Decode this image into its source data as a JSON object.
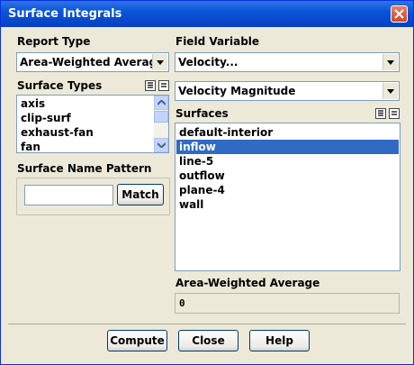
{
  "window": {
    "title": "Surface Integrals"
  },
  "report_type": {
    "label": "Report Type",
    "value": "Area-Weighted Average"
  },
  "surface_types": {
    "label": "Surface Types",
    "items": [
      "axis",
      "clip-surf",
      "exhaust-fan",
      "fan"
    ]
  },
  "surface_name_pattern": {
    "label": "Surface Name Pattern",
    "value": "",
    "match_label": "Match"
  },
  "field_variable": {
    "label": "Field Variable",
    "category": "Velocity...",
    "variable": "Velocity Magnitude"
  },
  "surfaces": {
    "label": "Surfaces",
    "items": [
      "default-interior",
      "inflow",
      "line-5",
      "outflow",
      "plane-4",
      "wall"
    ],
    "selected": "inflow"
  },
  "result": {
    "label": "Area-Weighted Average",
    "value": "0"
  },
  "buttons": {
    "compute": "Compute",
    "close": "Close",
    "help": "Help"
  },
  "icons": {
    "close": "close-icon",
    "dropdown": "chevron-down-icon",
    "select_all": "select-all-icon",
    "deselect_all": "deselect-all-icon"
  },
  "colors": {
    "title_bar": "#0a55d9",
    "selection": "#316ac5",
    "window_bg": "#ece9d8"
  }
}
